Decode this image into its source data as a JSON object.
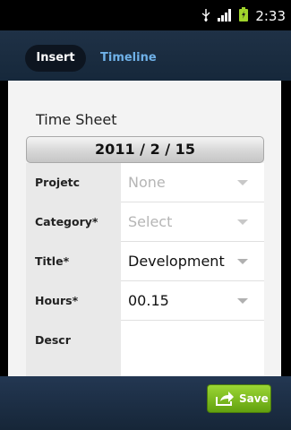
{
  "status_bar": {
    "time": "2:33",
    "icons": [
      "usb-icon",
      "signal-icon",
      "battery-charging-icon"
    ]
  },
  "tabs": [
    {
      "label": "Insert",
      "active": true
    },
    {
      "label": "Timeline",
      "active": false
    }
  ],
  "sheet": {
    "title": "Time Sheet",
    "date": "2011 / 2 / 15",
    "rows": [
      {
        "label": "Projetc",
        "value": "None",
        "is_hint": true
      },
      {
        "label": "Category",
        "required": "*",
        "value": "Select",
        "is_hint": true
      },
      {
        "label": "Title",
        "required": "*",
        "value": "Development",
        "is_hint": false
      },
      {
        "label": "Hours",
        "required": "*",
        "value": "00.15",
        "is_hint": false
      },
      {
        "label": "Descr",
        "value": ""
      }
    ]
  },
  "footer": {
    "save_label": "Save"
  },
  "colors": {
    "accent_tab": "#6fb1e8",
    "save_green": "#7bbd1e",
    "bar_navy": "#1f3146"
  }
}
